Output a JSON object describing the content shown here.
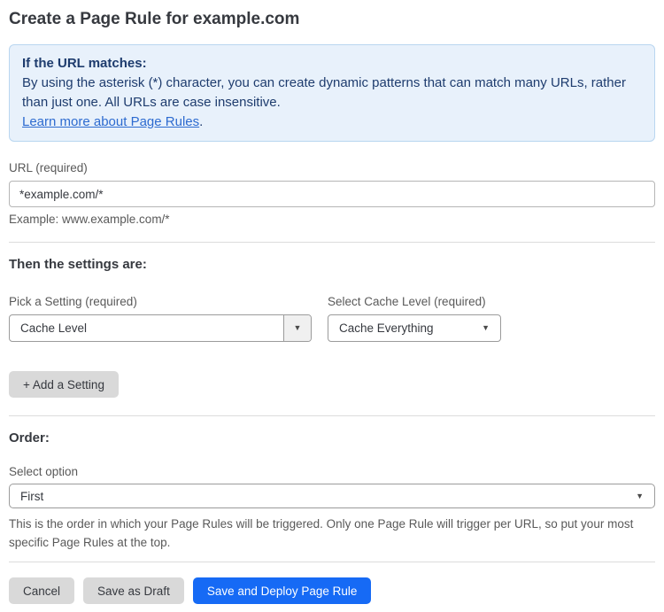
{
  "page": {
    "title": "Create a Page Rule for example.com"
  },
  "info_box": {
    "heading": "If the URL matches:",
    "body": "By using the asterisk (*) character, you can create dynamic patterns that can match many URLs, rather than just one. All URLs are case insensitive.",
    "link_text": "Learn more about Page Rules",
    "link_suffix": "."
  },
  "url_field": {
    "label": "URL (required)",
    "value": "*example.com/*",
    "example": "Example: www.example.com/*"
  },
  "settings_section": {
    "heading": "Then the settings are:",
    "setting_picker": {
      "label": "Pick a Setting (required)",
      "value": "Cache Level"
    },
    "cache_level_picker": {
      "label": "Select Cache Level (required)",
      "value": "Cache Everything"
    },
    "add_setting_label": "+ Add a Setting"
  },
  "order_section": {
    "heading": "Order:",
    "label": "Select option",
    "value": "First",
    "help_text": "This is the order in which your Page Rules will be triggered. Only one Page Rule will trigger per URL, so put your most specific Page Rules at the top."
  },
  "footer": {
    "cancel_label": "Cancel",
    "save_draft_label": "Save as Draft",
    "save_deploy_label": "Save and Deploy Page Rule"
  },
  "icons": {
    "dropdown_arrow": "▼"
  },
  "colors": {
    "primary_button": "#166af5",
    "button_gray": "#d9d9d9",
    "info_box_bg": "#e8f1fb",
    "info_box_border": "#b9d6f0",
    "info_text": "#1e3c6e",
    "link_color": "#2d6bd0"
  }
}
